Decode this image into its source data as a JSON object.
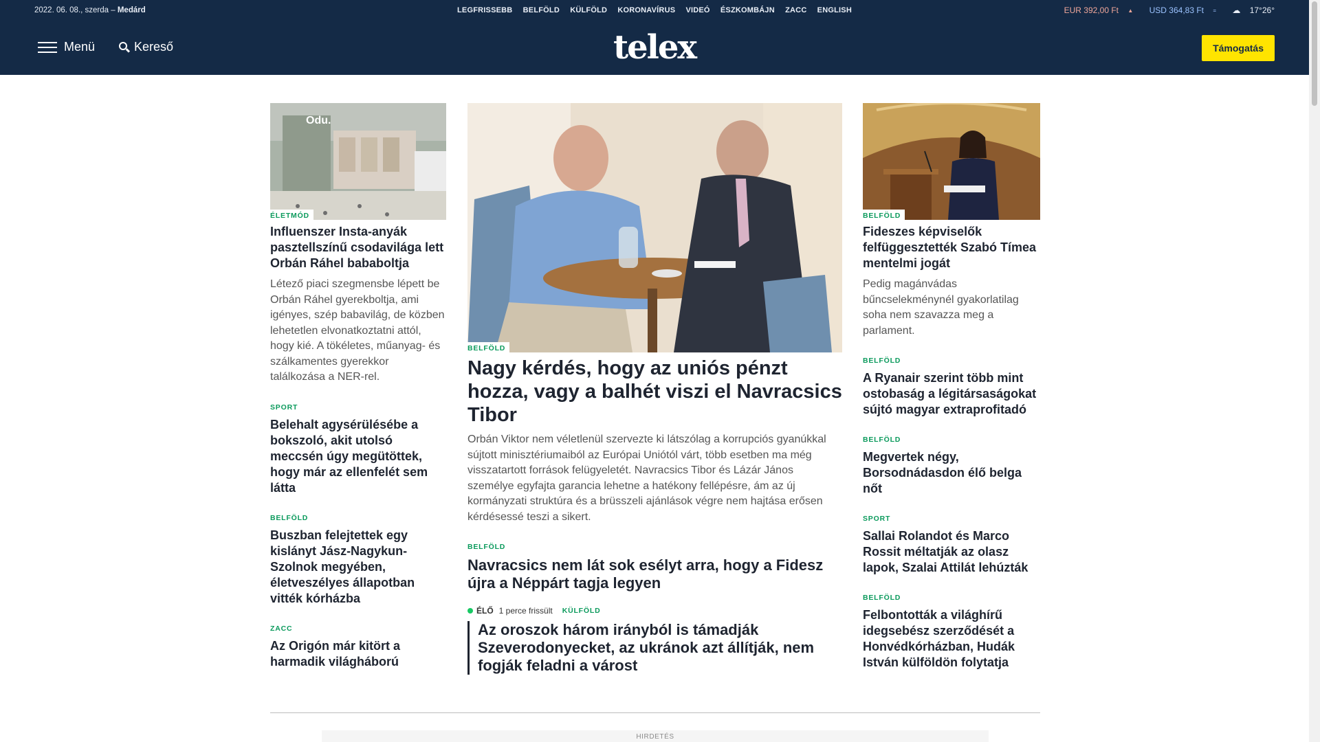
{
  "topbar": {
    "date": "2022. 06. 08., szerda –",
    "nameday": "Medárd",
    "nav": [
      "LEGFRISSEBB",
      "BELFÖLD",
      "KÜLFÖLD",
      "KORONAVÍRUS",
      "VIDEÓ",
      "ÉSZKOMBÁJN",
      "ZACC",
      "ENGLISH"
    ],
    "eur": "EUR 392,00 Ft",
    "usd": "USD 364,83 Ft",
    "weather": "17°26°"
  },
  "header": {
    "menu_label": "Menü",
    "search_label": "Kereső",
    "logo": "telex",
    "support_label": "Támogatás"
  },
  "left": {
    "lead": {
      "category": "ÉLETMÓD",
      "title": "Influenszer Insta-anyák pasztellszínű csodavilága lett Orbán Ráhel bababoltja",
      "lead": "Létező piaci szegmensbe lépett be Orbán Ráhel gyerekboltja, ami igényes, szép babavilág, de közben lehetetlen elvonatkoztatni attól, hogy kié. A tökéletes, műanyag- és szálkamentes gyerekkor találkozása a NER-rel.",
      "store_sign": "Odu."
    },
    "items": [
      {
        "category": "SPORT",
        "title": "Belehalt agysérülésébe a bokszoló, akit utolsó meccsén úgy megütöttek, hogy már az ellenfelét sem látta"
      },
      {
        "category": "BELFÖLD",
        "title": "Buszban felejtettek egy kislányt Jász-Nagykun-Szolnok megyében, életveszélyes állapotban vitték kórházba"
      },
      {
        "category": "ZACC",
        "title": "Az Origón már kitört a harmadik világháború"
      }
    ]
  },
  "mid": {
    "lead": {
      "category": "BELFÖLD",
      "title": "Nagy kérdés, hogy az uniós pénzt hozza, vagy a balhét viszi el Navracsics Tibor",
      "lead": "Orbán Viktor nem véletlenül szervezte ki látszólag a korrupciós gyanúkkal sújtott minisztériumaiból az Európai Uniótól várt, több esetben ma még visszatartott források felügyeletét. Navracsics Tibor és Lázár János személye egyfajta garancia lehetne a hatékony fellépésre, ám az új kormányzati struktúra és a brüsszeli ajánlások végre nem hajtása erősen kérdésessé teszi a sikert."
    },
    "second": {
      "category": "BELFÖLD",
      "title": "Navracsics nem lát sok esélyt arra, hogy a Fidesz újra a Néppárt tagja legyen"
    },
    "live": {
      "label": "ÉLŐ",
      "time": "1 perce  frissült",
      "category": "KÜLFÖLD",
      "title": "Az oroszok három irányból is támadják Szeverodonyecket, az ukránok azt állítják, nem fogják feladni a várost"
    }
  },
  "right": {
    "lead": {
      "category": "BELFÖLD",
      "title": "Fideszes képviselők felfüggesztették Szabó Tímea mentelmi jogát",
      "lead": "Pedig magánvádas bűncselekménynél gyakorlatilag soha nem szavazza meg a parlament."
    },
    "items": [
      {
        "category": "BELFÖLD",
        "title": "A Ryanair szerint több mint ostobaság a légitársaságokat sújtó magyar extraprofitadó"
      },
      {
        "category": "BELFÖLD",
        "title": "Megvertek négy, Borsodnádasdon élő belga nőt"
      },
      {
        "category": "SPORT",
        "title": "Sallai Rolandot és Marco Rossit méltatják az olasz lapok, Szalai Attilát lehúzták"
      },
      {
        "category": "BELFÖLD",
        "title": "Felbontották a világhírű idegsebész szerződését a Honvédkórházban, Hudák István külföldön folytatja"
      }
    ]
  },
  "ad": {
    "label": "HIRDETÉS"
  },
  "colors": {
    "navy": "#142a46",
    "accent_green": "#0b9a5c",
    "support_yellow": "#ffe400"
  }
}
